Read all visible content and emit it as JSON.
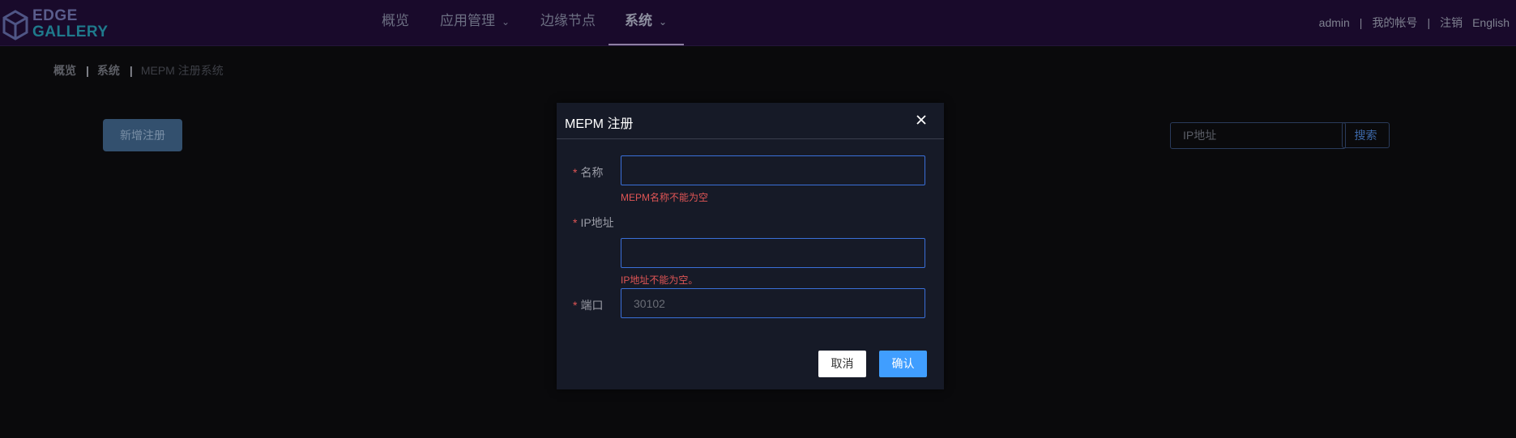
{
  "header": {
    "logo": {
      "line1": "EDGE",
      "line2": "GALLERY"
    },
    "nav": [
      {
        "label": "概览"
      },
      {
        "label": "应用管理"
      },
      {
        "label": "边缘节点"
      },
      {
        "label": "系统"
      }
    ],
    "user": {
      "username": "admin",
      "account": "我的帐号",
      "logout": "注销",
      "language": "English",
      "separator": "|"
    }
  },
  "breadcrumb": {
    "items": [
      "概览",
      "系统",
      "MEPM 注册系统"
    ],
    "separator": "|"
  },
  "toolbar": {
    "add_label": "新增注册",
    "search_placeholder": "IP地址",
    "search_label": "搜索"
  },
  "modal": {
    "title": "MEPM 注册",
    "required_mark": "*",
    "fields": {
      "name": {
        "label": "名称",
        "value": "",
        "error": "MEPM名称不能为空"
      },
      "ip": {
        "label": "IP地址",
        "value": "",
        "error": "IP地址不能为空。"
      },
      "port": {
        "label": "端口",
        "value": "30102"
      }
    },
    "cancel_label": "取消",
    "confirm_label": "确认"
  },
  "colors": {
    "accent": "#409eff",
    "error": "#e05555",
    "header_bg": "#190a2b",
    "modal_bg": "#161a27"
  }
}
